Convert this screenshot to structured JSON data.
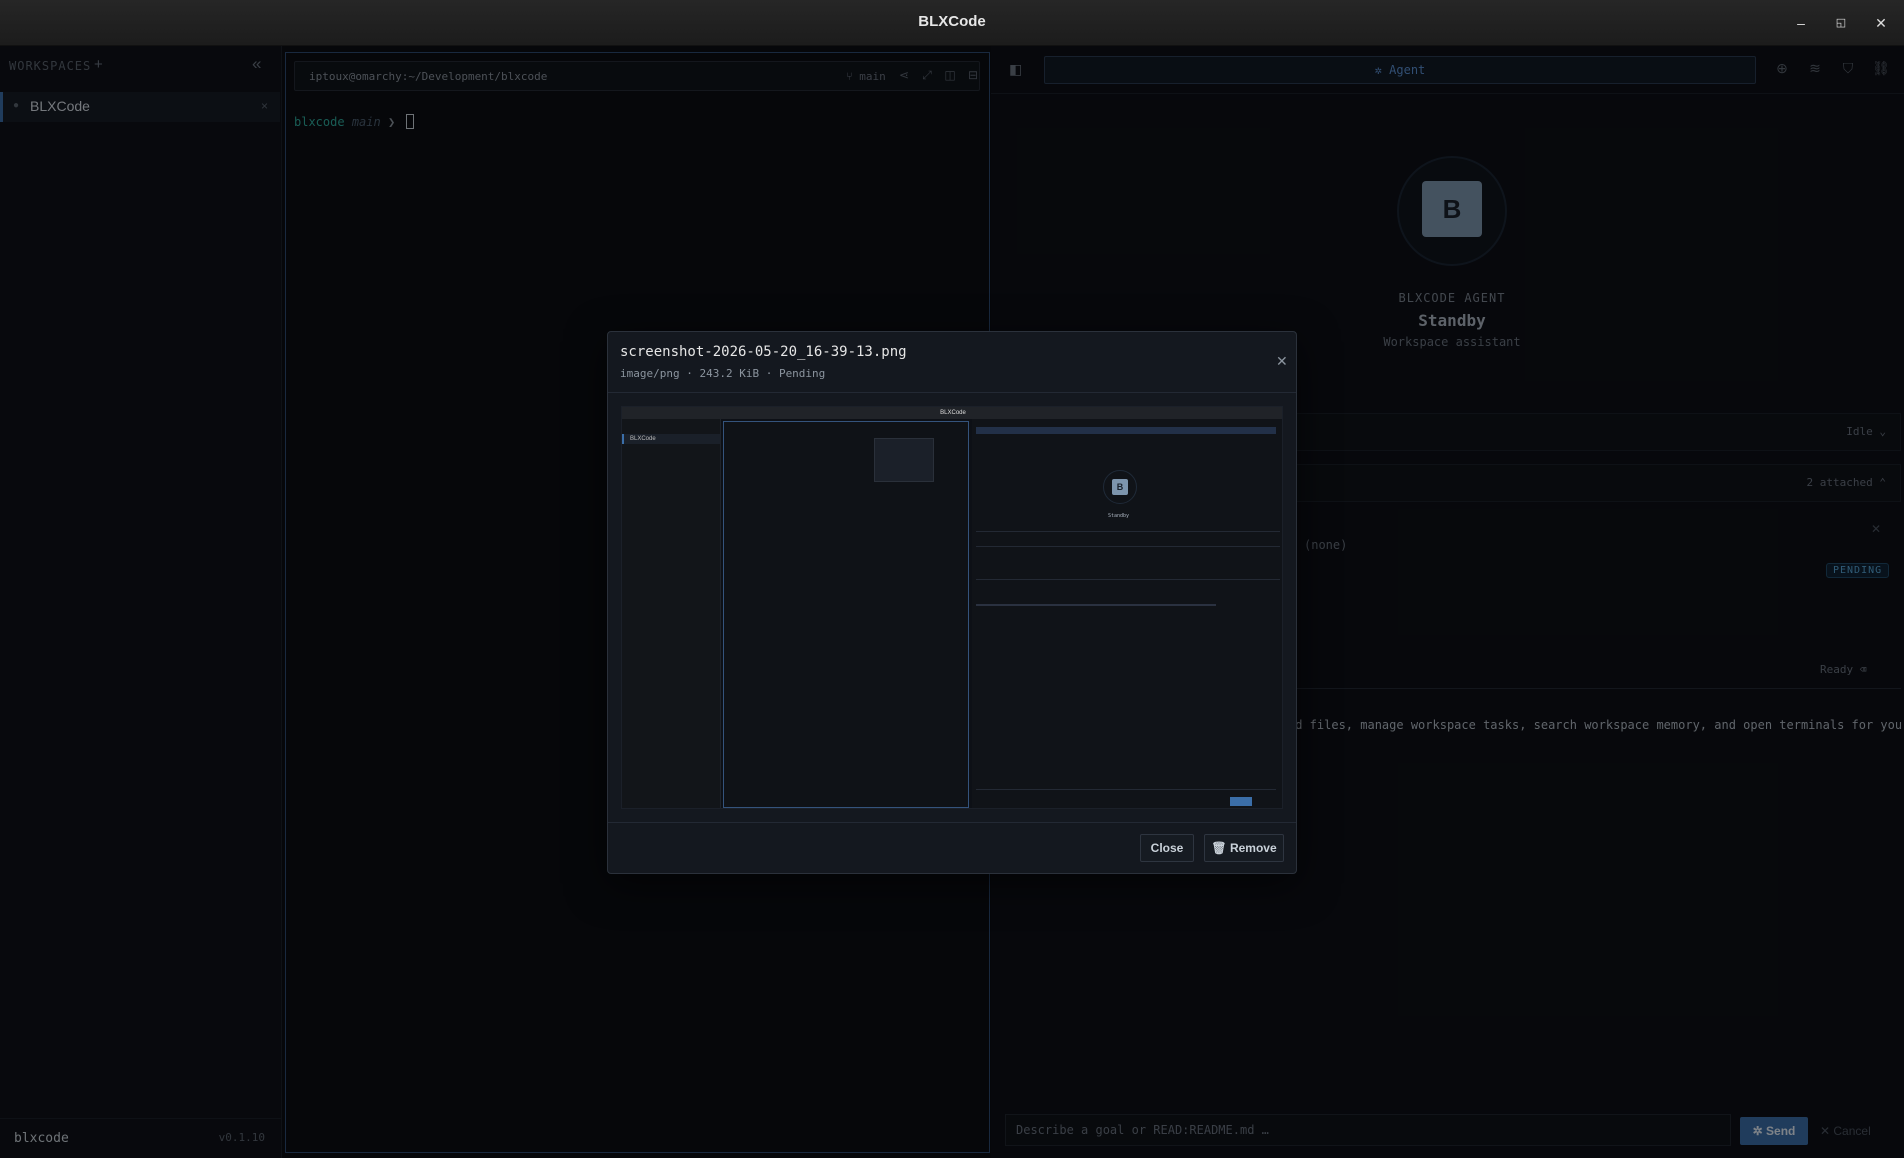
{
  "window": {
    "title": "BLXCode",
    "minimize_icon": "minimize-icon",
    "maximize_icon": "maximize-icon",
    "close_icon": "close-icon"
  },
  "sidebar": {
    "heading": "WORKSPACES",
    "add_label": "+",
    "collapse_label": "«",
    "items": [
      {
        "label": "BLXCode",
        "close": "×"
      }
    ],
    "footer": {
      "name": "blxcode",
      "version": "v0.1.10"
    }
  },
  "terminal": {
    "path": "iptoux@omarchy:~/Development/blxcode",
    "branch": "main",
    "prompt_dir": "blxcode",
    "prompt_branch": "main",
    "prompt_arrow": "❯"
  },
  "agent": {
    "tab_label": "Agent",
    "avatar_letter": "B",
    "kicker": "BLXCODE AGENT",
    "status": "Standby",
    "subtitle": "Workspace assistant",
    "tasks_status": "Idle ⌄",
    "context_count": "2 attached ⌃",
    "context_none": "(none)",
    "pending_badge": "PENDING",
    "chat_status": "Ready",
    "message_fragment": "ad files, manage workspace tasks, search workspace memory, and open terminals for you.",
    "composer_placeholder": "Describe a goal or READ:README.md …",
    "send_label": "Send",
    "cancel_label": "Cancel"
  },
  "modal": {
    "filename": "screenshot-2026-05-20_16-39-13.png",
    "meta": "image/png · 243.2 KiB · Pending",
    "close_label": "Close",
    "remove_label": "Remove",
    "preview": {
      "title": "BLXCode",
      "sidebar_item": "BLXCode",
      "avatar_letter": "B",
      "status": "Standby"
    }
  },
  "colors": {
    "accent": "#3b6ea8",
    "teal": "#2ea89b",
    "pending": "#58a6d8",
    "background": "#0b0e13"
  }
}
